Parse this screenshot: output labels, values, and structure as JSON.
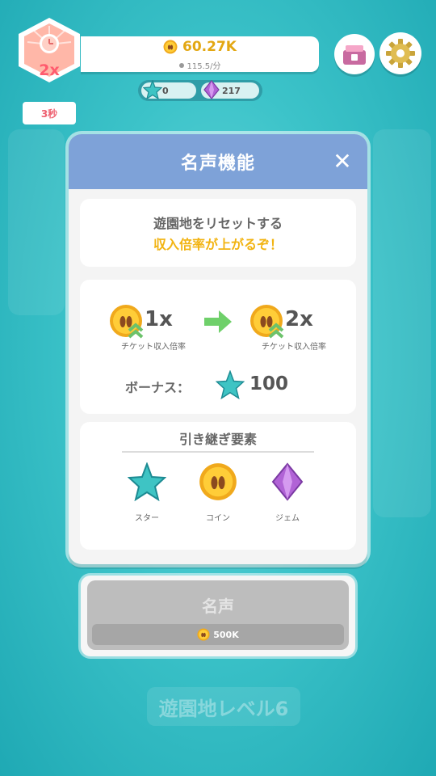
{
  "hud": {
    "multiplier_badge": "2x",
    "timer": "3秒",
    "coins": "60.27K",
    "coin_rate": "115.5/分",
    "stars": "0",
    "gems": "217"
  },
  "modal": {
    "title": "名声機能",
    "close_label": "✕",
    "info_line1": "遊園地をリセットする",
    "info_line2": "収入倍率が上がるぞ！",
    "current_multiplier": "1x",
    "current_label": "チケット収入倍率",
    "next_multiplier": "2x",
    "next_label": "チケット収入倍率",
    "bonus_label": "ボーナス：",
    "bonus_value": "100",
    "carryover_title": "引き継ぎ要素",
    "carry_items": [
      {
        "label": "スター",
        "icon": "star-icon"
      },
      {
        "label": "コイン",
        "icon": "coin-icon"
      },
      {
        "label": "ジェム",
        "icon": "gem-icon"
      }
    ]
  },
  "fame_button": {
    "label": "名声",
    "cost": "500K"
  },
  "background": {
    "level_text": "遊園地レベル6"
  },
  "colors": {
    "header_blue": "#7ea2d8",
    "accent_gold": "#f2b413",
    "teal_bg": "#3cc3c9",
    "disabled_gray": "#bdbdbd"
  }
}
